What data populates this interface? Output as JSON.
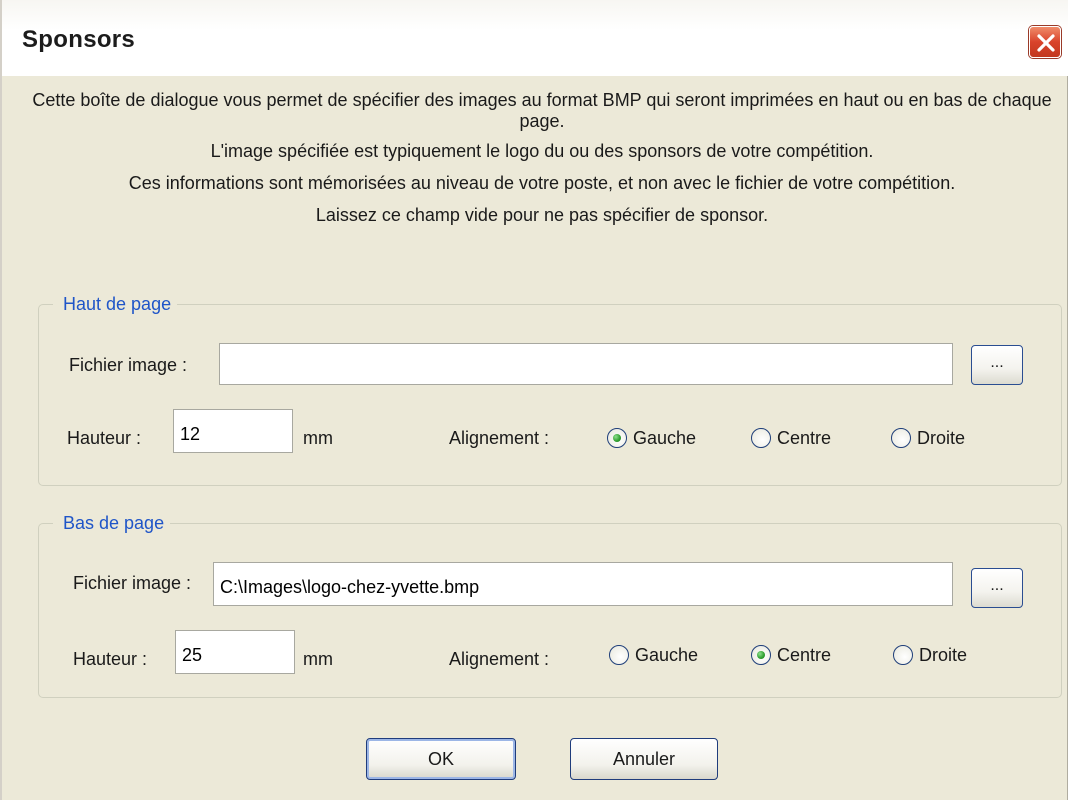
{
  "window": {
    "title": "Sponsors"
  },
  "intro": {
    "line1": "Cette boîte de dialogue vous permet de spécifier des images au format BMP qui seront imprimées en haut ou en bas de chaque page.",
    "line2": "L'image spécifiée est typiquement le logo du ou des sponsors de votre compétition.",
    "line3": "Ces informations sont mémorisées au niveau de votre poste, et non avec le fichier de votre compétition.",
    "line4": "Laissez ce champ vide pour ne pas spécifier de sponsor."
  },
  "header_group": {
    "legend": "Haut de page",
    "file_label": "Fichier image :",
    "file_value": "",
    "browse_label": "...",
    "height_label": "Hauteur :",
    "height_value": "12",
    "unit": "mm",
    "align_label": "Alignement :",
    "options": [
      "Gauche",
      "Centre",
      "Droite"
    ],
    "selected": "Gauche"
  },
  "footer_group": {
    "legend": "Bas de page",
    "file_label": "Fichier image :",
    "file_value": "C:\\Images\\logo-chez-yvette.bmp",
    "browse_label": "...",
    "height_label": "Hauteur :",
    "height_value": "25",
    "unit": "mm",
    "align_label": "Alignement :",
    "options": [
      "Gauche",
      "Centre",
      "Droite"
    ],
    "selected": "Centre"
  },
  "buttons": {
    "ok": "OK",
    "cancel": "Annuler"
  },
  "icons": {
    "close": "close-icon",
    "radio_selected_color": "#2e9e2e",
    "legend_color": "#1f55c8",
    "close_button_color": "#d9432b"
  }
}
